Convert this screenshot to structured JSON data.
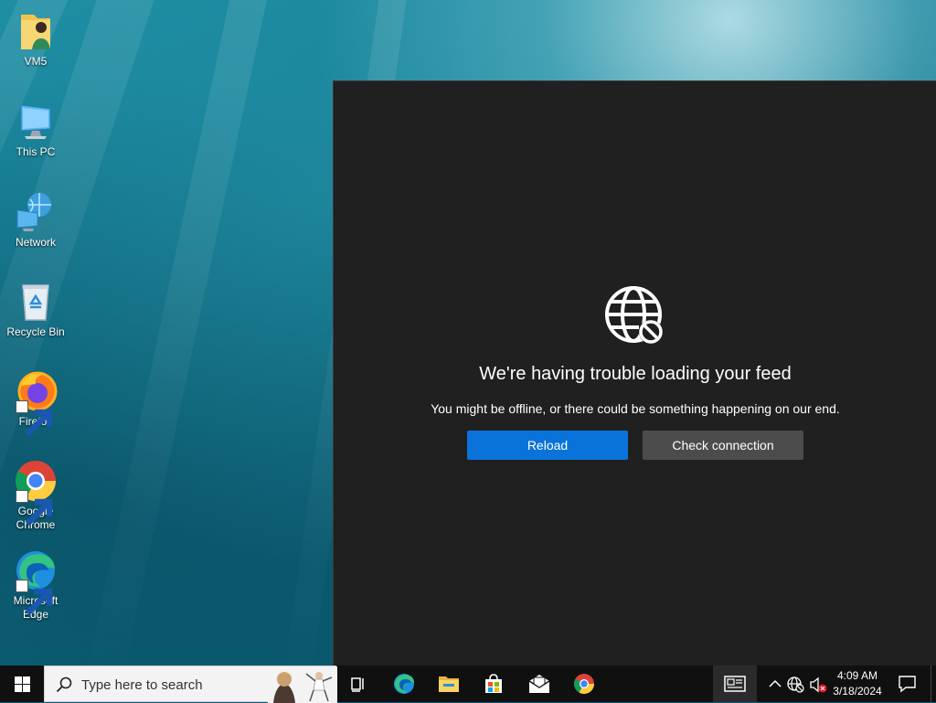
{
  "desktop": {
    "icons": [
      {
        "label": "VM5"
      },
      {
        "label": "This PC"
      },
      {
        "label": "Network"
      },
      {
        "label": "Recycle Bin"
      },
      {
        "label": "Firefox"
      },
      {
        "label": "Google Chrome"
      },
      {
        "label": "Microsoft Edge"
      }
    ]
  },
  "feed": {
    "title": "We're having trouble loading your feed",
    "message": "You might be offline, or there could be something happening on our end.",
    "reload_label": "Reload",
    "check_connection_label": "Check connection",
    "accent_color": "#0a73d9"
  },
  "taskbar": {
    "search_placeholder": "Type here to search",
    "pinned": [
      "task-view-icon",
      "edge-icon",
      "file-explorer-icon",
      "store-icon",
      "mail-icon",
      "chrome-icon",
      "news-icon"
    ],
    "tray": {
      "icons": [
        "chevron-up-icon",
        "network-globe-icon",
        "volume-muted-icon"
      ],
      "time": "4:09 AM",
      "date": "3/18/2024"
    }
  }
}
